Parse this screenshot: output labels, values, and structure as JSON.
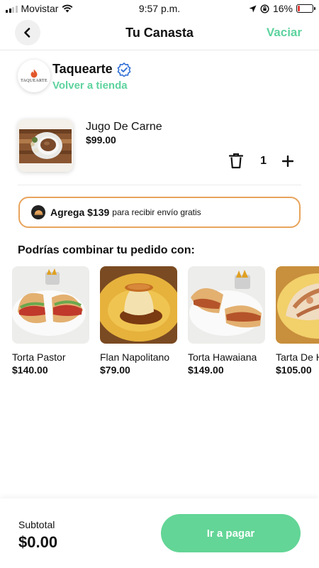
{
  "status_bar": {
    "carrier": "Movistar",
    "time": "9:57 p.m.",
    "battery_percent": "16%",
    "battery_level": 0.16,
    "battery_color": "#e53935"
  },
  "header": {
    "back_icon": "chevron-left-icon",
    "title": "Tu Canasta",
    "action_label": "Vaciar",
    "accent_color": "#5dd39e"
  },
  "store": {
    "logo_text": "TAQUEARTE",
    "name": "Taquearte",
    "verified_icon": "verified-badge-icon",
    "back_link": "Volver a tienda"
  },
  "cart_items": [
    {
      "name": "Jugo De Carne",
      "price": "$99.00",
      "quantity": "1",
      "delete_icon": "trash-icon",
      "add_icon": "plus-icon"
    }
  ],
  "promo": {
    "icon": "delivery-icon",
    "strong_text": "Agrega $139",
    "text": "para recibir envío gratis",
    "border_color": "#e8a45c"
  },
  "suggestions": {
    "title": "Podrías combinar tu pedido con:",
    "items": [
      {
        "name": "Torta Pastor",
        "price": "$140.00"
      },
      {
        "name": "Flan Napolitano",
        "price": "$79.00"
      },
      {
        "name": "Torta Hawaiana",
        "price": "$149.00"
      },
      {
        "name": "Tarta De H",
        "price": "$105.00"
      }
    ]
  },
  "footer": {
    "subtotal_label": "Subtotal",
    "subtotal_value": "$0.00",
    "pay_button": "Ir a pagar",
    "pay_color": "#63d596"
  }
}
